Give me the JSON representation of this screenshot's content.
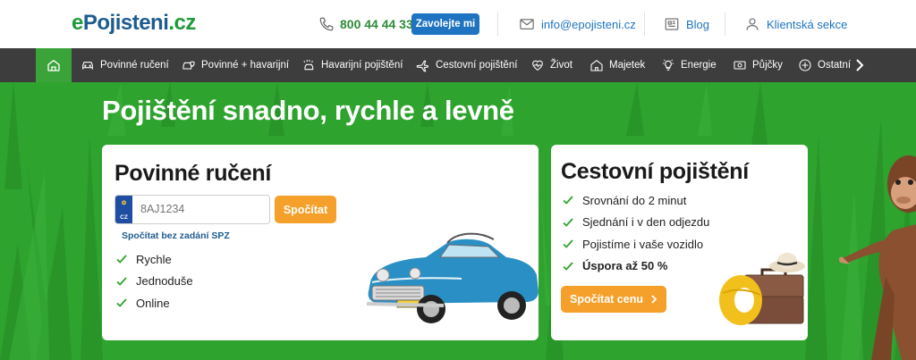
{
  "header": {
    "logo": {
      "e": "e",
      "name": "Pojisteni",
      "tld": ".cz"
    },
    "phone": "800 44 44 33",
    "call_button": "Zavolejte mi",
    "email": "info@epojisteni.cz",
    "blog": "Blog",
    "client": "Klientská sekce"
  },
  "nav": {
    "items": [
      {
        "label": "Povinné ručení",
        "icon": "car-icon"
      },
      {
        "label": "Povinné + havarijní",
        "icon": "car-shield-icon"
      },
      {
        "label": "Havarijní pojištění",
        "icon": "crash-icon"
      },
      {
        "label": "Cestovní pojištění",
        "icon": "plane-icon"
      },
      {
        "label": "Život",
        "icon": "heart-icon"
      },
      {
        "label": "Majetek",
        "icon": "house-icon"
      },
      {
        "label": "Energie",
        "icon": "bulb-icon"
      },
      {
        "label": "Půjčky",
        "icon": "money-icon"
      },
      {
        "label": "Ostatní",
        "icon": "plus-circle-icon"
      }
    ]
  },
  "hero": {
    "title": "Pojištění snadno, rychle a levně"
  },
  "card_liability": {
    "title": "Povinné ručení",
    "plate_country": "CZ",
    "plate_placeholder": "8AJ1234",
    "calc_button": "Spočítat",
    "no_spz_link": "Spočítat bez zadání SPZ",
    "benefits": [
      "Rychle",
      "Jednoduše",
      "Online"
    ]
  },
  "card_travel": {
    "title": "Cestovní pojištění",
    "benefits": [
      "Srovnání do 2 minut",
      "Sjednání i v den odjezdu",
      "Pojistíme i vaše vozidlo"
    ],
    "highlight": "Úspora až 50 %",
    "price_button": "Spočítat cenu"
  },
  "colors": {
    "brand_green": "#2ea32e",
    "brand_blue": "#1e74c0",
    "accent_orange": "#f5a02a",
    "nav_dark": "#3d3d3d"
  }
}
